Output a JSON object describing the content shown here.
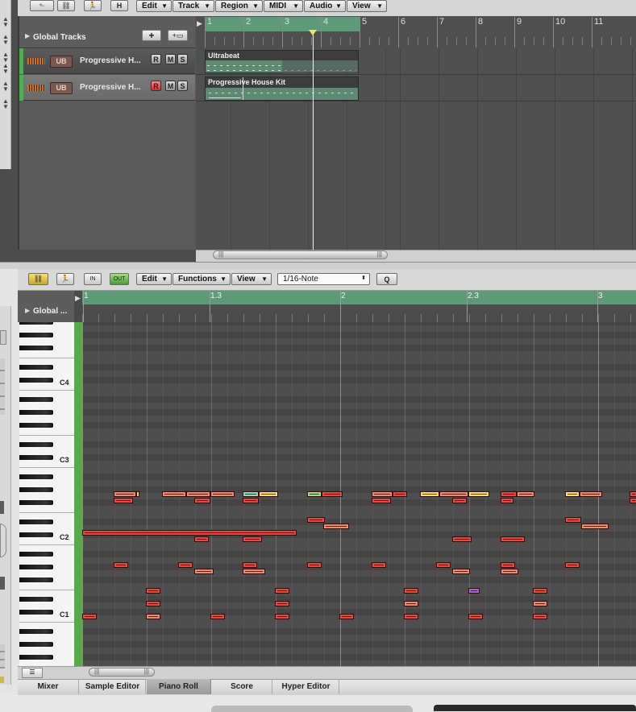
{
  "arrange": {
    "toolbar_btn_h": "H",
    "menus": [
      "Edit",
      "Track",
      "Region",
      "MIDI",
      "Audio",
      "View"
    ],
    "global_tracks_label": "Global Tracks",
    "ruler_bars": [
      "1",
      "2",
      "3",
      "4",
      "5",
      "6",
      "7",
      "8",
      "9",
      "10",
      "11"
    ],
    "tracks": [
      {
        "name": "Progressive H...",
        "icon_label": "UB",
        "record_armed": false
      },
      {
        "name": "Progressive H...",
        "icon_label": "UB",
        "record_armed": true
      }
    ],
    "rms_labels": [
      "R",
      "M",
      "S"
    ],
    "regions": [
      {
        "name": "Ultrabeat"
      },
      {
        "name": "Progressive House Kit"
      }
    ]
  },
  "piano_roll": {
    "menus": [
      "Edit",
      "Functions",
      "View"
    ],
    "quantize_value": "1/16-Note",
    "q_button": "Q",
    "global_label": "Global ...",
    "ruler_labels": [
      "1",
      "1.3",
      "2",
      "2.3",
      "3"
    ],
    "c_labels": [
      "C4",
      "C3",
      "C2",
      "C1"
    ]
  },
  "tabs": [
    "Mixer",
    "Sample Editor",
    "Piano Roll",
    "Score",
    "Hyper Editor"
  ],
  "selected_tab": "Piano Roll",
  "colors": {
    "accent_green": "#5f9a78",
    "note_red": "#e24a43",
    "note_salmon": "#f08a6e",
    "note_yellow": "#f2e36a",
    "note_purple": "#9b6ad9",
    "note_green": "#9ee07a"
  }
}
